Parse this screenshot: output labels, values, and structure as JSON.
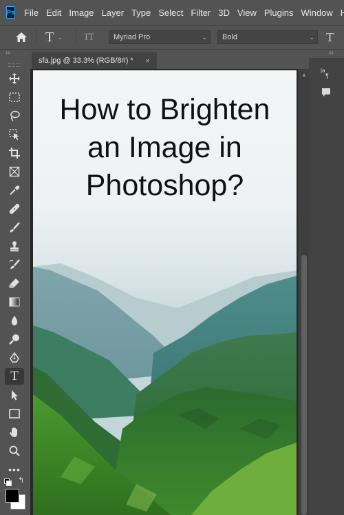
{
  "menu": {
    "logo": "Ps",
    "items": [
      "File",
      "Edit",
      "Image",
      "Layer",
      "Type",
      "Select",
      "Filter",
      "3D",
      "View",
      "Plugins",
      "Window",
      "He"
    ]
  },
  "options": {
    "text_tool_glyph": "T",
    "orient_glyph": "IT",
    "font_family": "Myriad Pro",
    "font_style": "Bold",
    "size_glyph": "T"
  },
  "panels": {
    "left_collapse": "››",
    "right_collapse": "‹‹"
  },
  "document": {
    "tab_title": "sfa.jpg @ 33.3% (RGB/8#) *",
    "close_glyph": "×",
    "headline": [
      "How to Brighten",
      "an Image in",
      "Photoshop?"
    ]
  },
  "toolbar": {
    "active_tool": "type-tool",
    "tools": [
      "move",
      "marquee",
      "lasso",
      "object-select",
      "crop",
      "frame",
      "eyedropper",
      "healing",
      "brush",
      "clone-stamp",
      "history-brush",
      "eraser",
      "gradient",
      "blur",
      "dodge",
      "pen",
      "type",
      "path-select",
      "rectangle",
      "hand",
      "zoom",
      "more",
      "default-colors",
      "swap-colors"
    ],
    "foreground_color": "#000000",
    "background_color": "#ffffff"
  },
  "colors": {
    "ui_bg": "#535353",
    "canvas_bg": "#282828",
    "accent": "#31a8ff"
  }
}
